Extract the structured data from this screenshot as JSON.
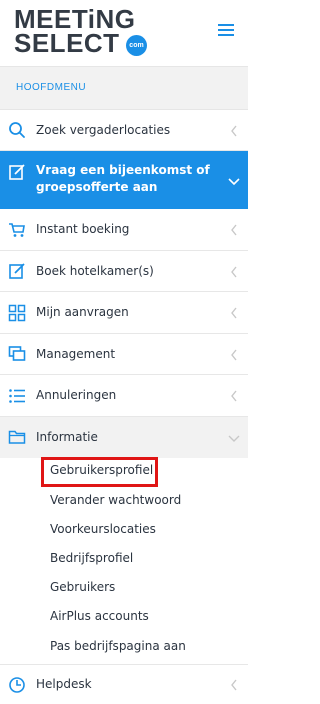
{
  "logo": {
    "line1": "MEETiNG",
    "line2": "SELECT",
    "badge": "com"
  },
  "colors": {
    "accent": "#1a8fe6",
    "highlight": "#e01515",
    "text": "#2b3440"
  },
  "menu_heading": "HOOFDMENU",
  "items": [
    {
      "label": "Zoek vergaderlocaties",
      "icon": "search-icon"
    },
    {
      "label": "Vraag een bijeenkomst of groepsofferte aan",
      "icon": "edit-icon",
      "active": true
    },
    {
      "label": "Instant boeking",
      "icon": "cart-icon"
    },
    {
      "label": "Boek hotelkamer(s)",
      "icon": "edit-icon"
    },
    {
      "label": "Mijn aanvragen",
      "icon": "grid-icon"
    },
    {
      "label": "Management",
      "icon": "windows-icon"
    },
    {
      "label": "Annuleringen",
      "icon": "list-icon"
    },
    {
      "label": "Informatie",
      "icon": "folder-icon",
      "expanded": true
    },
    {
      "label": "Helpdesk",
      "icon": "clock-icon"
    }
  ],
  "submenu": [
    "Gebruikersprofiel",
    "Verander wachtwoord",
    "Voorkeurslocaties",
    "Bedrijfsprofiel",
    "Gebruikers",
    "AirPlus accounts",
    "Pas bedrijfspagina aan"
  ]
}
